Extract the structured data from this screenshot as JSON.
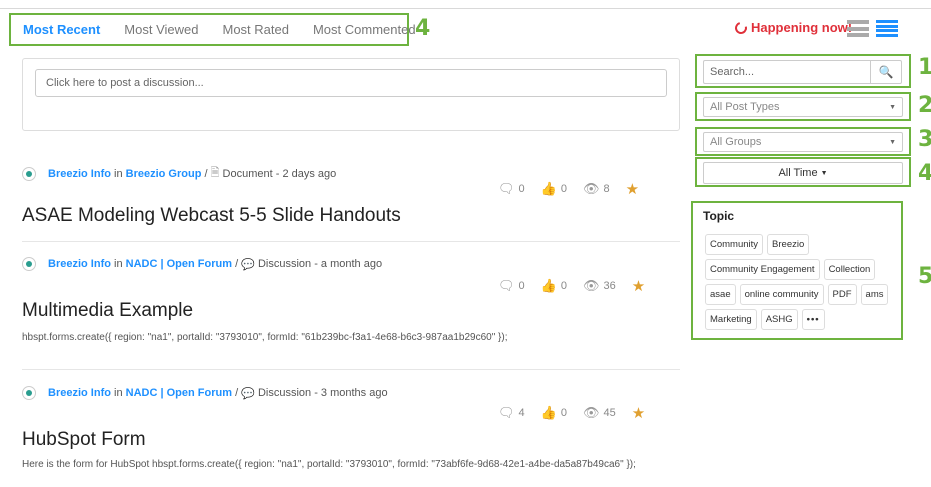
{
  "tabs": [
    {
      "label": "Most Recent",
      "active": true
    },
    {
      "label": "Most Viewed"
    },
    {
      "label": "Most Rated"
    },
    {
      "label": "Most Commented"
    }
  ],
  "annotations": {
    "tabs": "4",
    "search": "1",
    "post_types": "2",
    "groups": "3",
    "time": "4",
    "topic": "5"
  },
  "happening": "Happening now!",
  "post_placeholder": "Click here to post a discussion...",
  "feed": [
    {
      "author": "Breezio Info",
      "in": "in",
      "group": "Breezio Group",
      "sep": "/",
      "type_icon": "document-icon",
      "type": "Document",
      "time": "- 2 days ago",
      "comments": "0",
      "likes": "0",
      "views": "8",
      "title": "ASAE Modeling Webcast 5-5 Slide Handouts",
      "excerpt": ""
    },
    {
      "author": "Breezio Info",
      "in": "in",
      "group": "NADC | Open Forum",
      "sep": "/",
      "type_icon": "discussion-icon",
      "type": "Discussion",
      "time": "- a month ago",
      "comments": "0",
      "likes": "0",
      "views": "36",
      "title": "Multimedia Example",
      "excerpt": "hbspt.forms.create({ region: \"na1\", portalId: \"3793010\", formId: \"61b239bc-f3a1-4e68-b6c3-987aa1b29c60\" });"
    },
    {
      "author": "Breezio Info",
      "in": "in",
      "group": "NADC | Open Forum",
      "sep": "/",
      "type_icon": "discussion-icon",
      "type": "Discussion",
      "time": "- 3 months ago",
      "comments": "4",
      "likes": "0",
      "views": "45",
      "title": "HubSpot Form",
      "excerpt": "Here is the form for HubSpot hbspt.forms.create({ region: \"na1\", portalId: \"3793010\", formId: \"73abf6fe-9d68-42e1-a4be-da5a87b49ca6\" });"
    }
  ],
  "sidebar": {
    "search_placeholder": "Search...",
    "post_types": "All Post Types",
    "groups": "All Groups",
    "time": "All Time",
    "topic_title": "Topic",
    "tags": [
      "Community",
      "Breezio",
      "Community Engagement",
      "Collection",
      "asae",
      "online community",
      "PDF",
      "ams",
      "Marketing",
      "ASHG",
      "•••"
    ]
  },
  "colors": {
    "accent": "#1e90ff",
    "annotation": "#6db33f",
    "live": "#e0303a",
    "star": "#e0a030"
  }
}
